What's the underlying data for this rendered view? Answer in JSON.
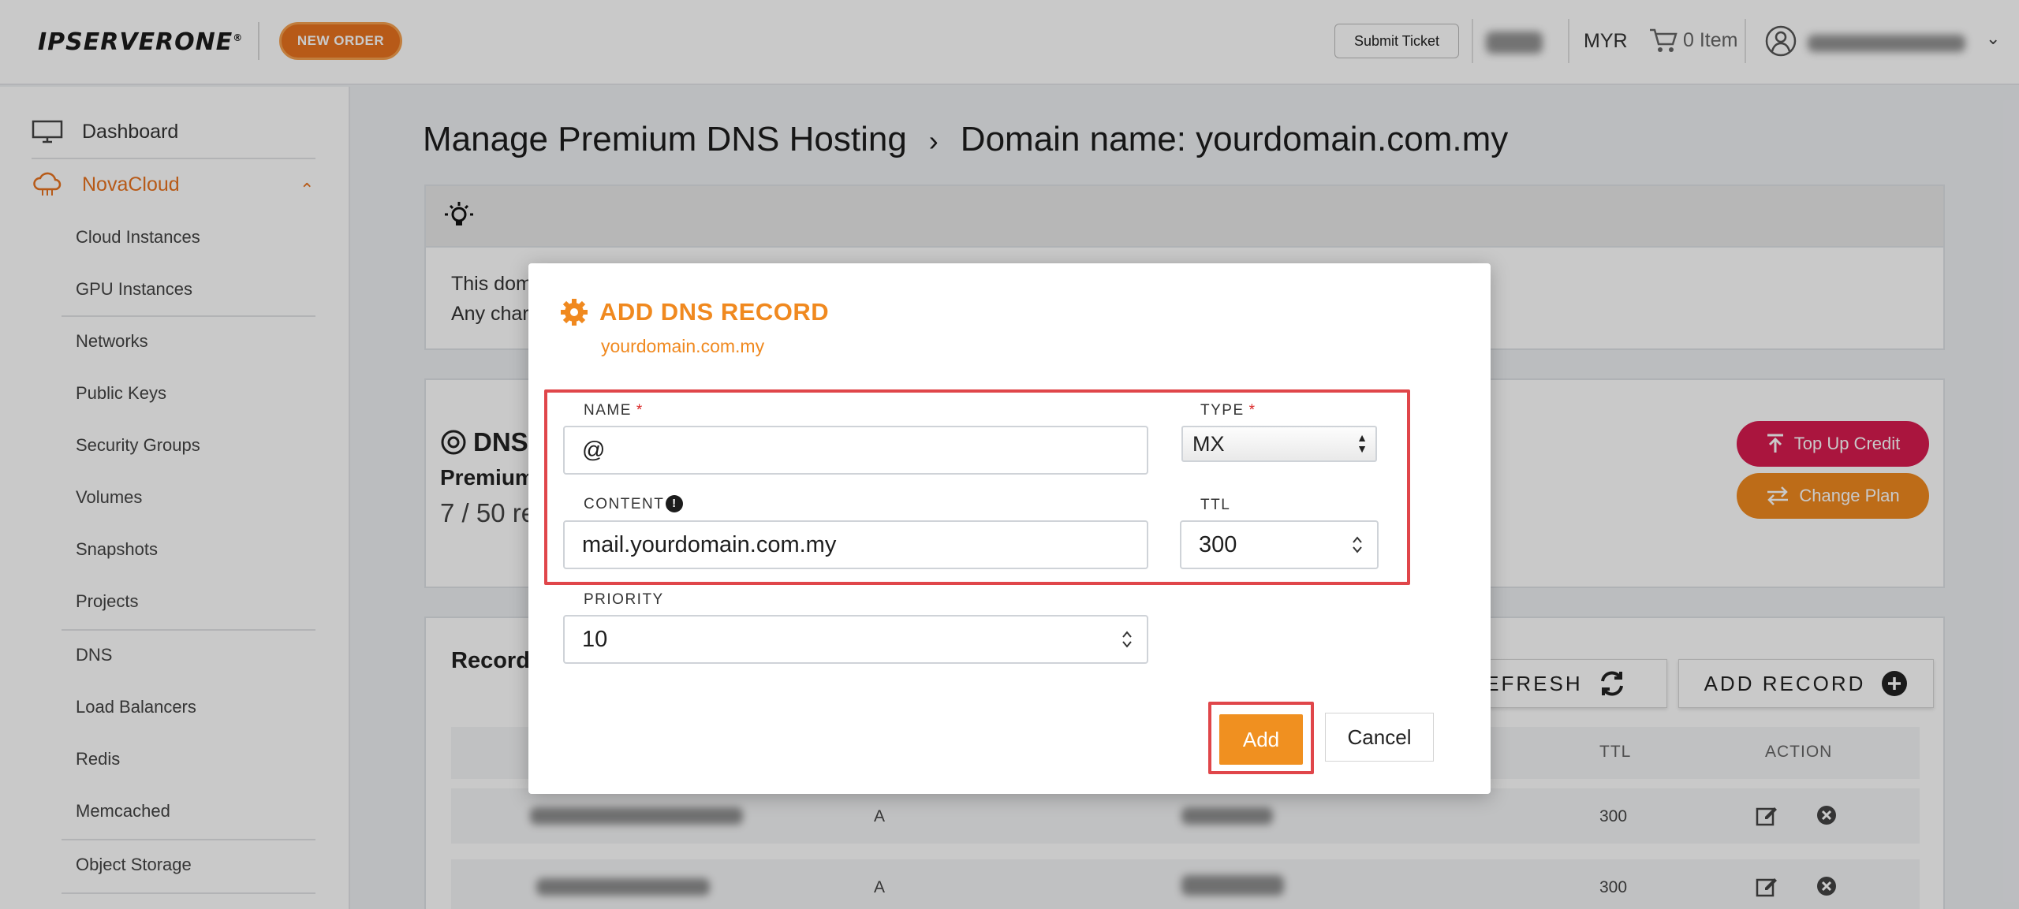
{
  "header": {
    "logo_text": "IPSERVERONE",
    "new_order_label": "NEW ORDER",
    "submit_ticket_label": "Submit Ticket",
    "currency": "MYR",
    "cart_label": "0 Item"
  },
  "sidebar": {
    "dashboard_label": "Dashboard",
    "section_label": "NovaCloud",
    "items": [
      "Cloud Instances",
      "GPU Instances",
      "Networks",
      "Public Keys",
      "Security Groups",
      "Volumes",
      "Snapshots",
      "Projects",
      "DNS",
      "Load Balancers",
      "Redis",
      "Memcached",
      "Object Storage"
    ]
  },
  "page": {
    "breadcrumb_root": "Manage Premium DNS Hosting",
    "breadcrumb_sep": "›",
    "breadcrumb_current": "Domain name: yourdomain.com.my",
    "info_line_1": "This dom",
    "info_line_2": "Any char",
    "dns_title": "DNS",
    "plan_name": "Premium",
    "records_count": "7 / 50 re",
    "top_up_label": "Top Up Credit",
    "change_plan_label": "Change Plan",
    "records_title": "Record",
    "refresh_label": "REFRESH",
    "add_record_label": "ADD RECORD",
    "table": {
      "col_ttl": "TTL",
      "col_action": "ACTION",
      "rows": [
        {
          "type": "A",
          "ttl": "300"
        },
        {
          "type": "A",
          "ttl": "300"
        }
      ]
    }
  },
  "modal": {
    "title": "ADD DNS RECORD",
    "subtitle": "yourdomain.com.my",
    "name_label": "NAME",
    "name_value": "@",
    "type_label": "TYPE",
    "type_value": "MX",
    "content_label": "CONTENT",
    "content_value": "mail.yourdomain.com.my",
    "ttl_label": "TTL",
    "ttl_value": "300",
    "priority_label": "PRIORITY",
    "priority_value": "10",
    "required_mark": "*",
    "add_label": "Add",
    "cancel_label": "Cancel"
  },
  "colors": {
    "accent": "#f0891f",
    "brand_orange": "#e8731f",
    "danger": "#d81b4f",
    "highlight": "#e0464a"
  },
  "icons": [
    "monitor-icon",
    "cloud-icon",
    "chevron-up-icon",
    "bulb-icon",
    "dns-icon",
    "upload-icon",
    "swap-icon",
    "refresh-icon",
    "plus-circle-icon",
    "edit-icon",
    "delete-icon",
    "gear-icon",
    "cart-icon",
    "user-icon",
    "chevron-down-icon",
    "info-icon"
  ]
}
